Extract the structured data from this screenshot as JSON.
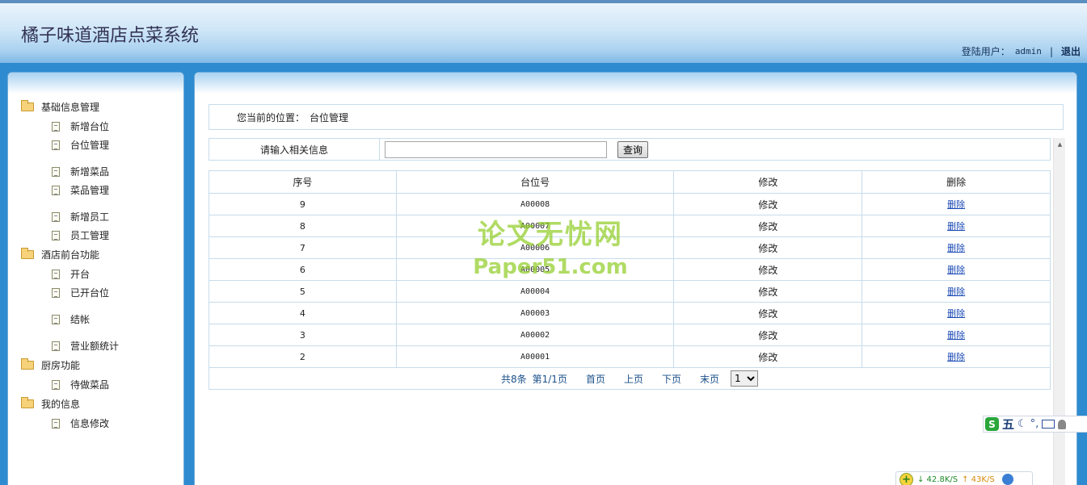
{
  "app": {
    "title": "橘子味道酒店点菜系统",
    "login_label": "登陆用户：",
    "username": "admin",
    "separator": "|",
    "logout_label": "退出"
  },
  "sidebar": {
    "groups": [
      {
        "title": "基础信息管理",
        "items": [
          "新增台位",
          "台位管理",
          "新增菜品",
          "菜品管理",
          "新增员工",
          "员工管理"
        ]
      },
      {
        "title": "酒店前台功能",
        "items": [
          "开台",
          "已开台位",
          "结帐",
          "营业额统计"
        ]
      },
      {
        "title": "厨房功能",
        "items": [
          "待做菜品"
        ]
      },
      {
        "title": "我的信息",
        "items": [
          "信息修改"
        ]
      }
    ]
  },
  "breadcrumb": {
    "prefix": "您当前的位置：",
    "current": "台位管理"
  },
  "search": {
    "label": "请输入相关信息",
    "value": "",
    "button_label": "查询"
  },
  "table": {
    "headers": [
      "序号",
      "台位号",
      "修改",
      "删除"
    ],
    "rows": [
      {
        "no": "9",
        "code": "A00008",
        "edit": "修改",
        "delete": "删除"
      },
      {
        "no": "8",
        "code": "A00007",
        "edit": "修改",
        "delete": "删除"
      },
      {
        "no": "7",
        "code": "A00006",
        "edit": "修改",
        "delete": "删除"
      },
      {
        "no": "6",
        "code": "A00005",
        "edit": "修改",
        "delete": "删除"
      },
      {
        "no": "5",
        "code": "A00004",
        "edit": "修改",
        "delete": "删除"
      },
      {
        "no": "4",
        "code": "A00003",
        "edit": "修改",
        "delete": "删除"
      },
      {
        "no": "3",
        "code": "A00002",
        "edit": "修改",
        "delete": "删除"
      },
      {
        "no": "2",
        "code": "A00001",
        "edit": "修改",
        "delete": "删除"
      }
    ]
  },
  "pager": {
    "total": "共8条",
    "page_info": "第1/1页",
    "first": "首页",
    "prev": "上页",
    "next": "下页",
    "last": "末页",
    "selected_page": "1"
  },
  "watermark": {
    "line1": "论文无忧网",
    "line2": "Paper51.com"
  },
  "ime": {
    "logo": "S",
    "mode": "五",
    "moon": "☾",
    "punct": "°,"
  },
  "netspeed": {
    "plus": "+",
    "down": "↓ 42.8K/S",
    "up": "↑ 43K/S"
  },
  "colors": {
    "header_top": "#eaf4fc",
    "header_bottom": "#7fb9e5",
    "body_bg": "#2e8bd0",
    "border": "#c7dceb",
    "link": "#1a49b4"
  }
}
